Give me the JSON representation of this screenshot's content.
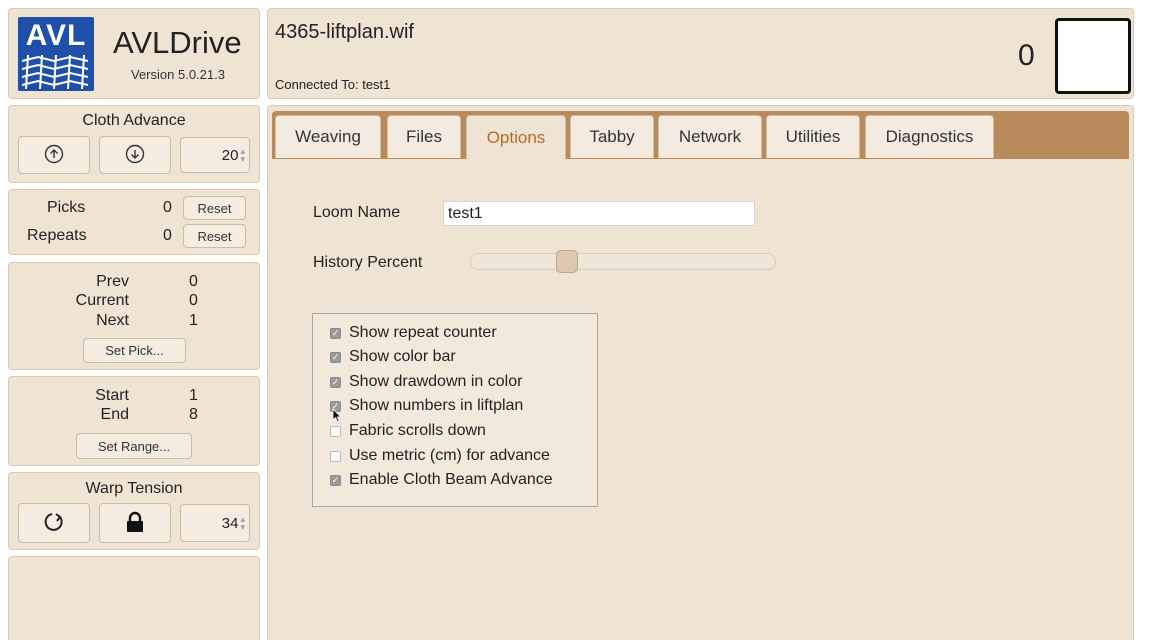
{
  "app": {
    "logo_text": "AVL",
    "name": "AVLDrive",
    "version": "Version 5.0.21.3"
  },
  "header": {
    "file_name": "4365-liftplan.wif",
    "connected": "Connected To: test1",
    "counter": "0"
  },
  "cloth_advance": {
    "title": "Cloth Advance",
    "up_icon": "arrow-up-circle-icon",
    "down_icon": "arrow-down-circle-icon",
    "value": "20"
  },
  "counters": {
    "picks_label": "Picks",
    "picks_value": "0",
    "repeats_label": "Repeats",
    "repeats_value": "0",
    "reset_label": "Reset"
  },
  "pick_info": {
    "prev_label": "Prev",
    "prev_value": "0",
    "current_label": "Current",
    "current_value": "0",
    "next_label": "Next",
    "next_value": "1",
    "set_pick_label": "Set Pick..."
  },
  "range": {
    "start_label": "Start",
    "start_value": "1",
    "end_label": "End",
    "end_value": "8",
    "set_range_label": "Set Range..."
  },
  "warp_tension": {
    "title": "Warp Tension",
    "value": "34",
    "refresh_icon": "refresh-icon",
    "lock_icon": "lock-icon"
  },
  "tabs": [
    {
      "label": "Weaving"
    },
    {
      "label": "Files"
    },
    {
      "label": "Options",
      "active": true
    },
    {
      "label": "Tabby"
    },
    {
      "label": "Network"
    },
    {
      "label": "Utilities"
    },
    {
      "label": "Diagnostics"
    }
  ],
  "options": {
    "loom_name_label": "Loom Name",
    "loom_name_value": "test1",
    "history_label": "History Percent",
    "history_value_fraction": 0.3,
    "checkboxes": [
      {
        "label": "Show repeat counter",
        "checked": true
      },
      {
        "label": "Show color bar",
        "checked": true
      },
      {
        "label": "Show drawdown in color",
        "checked": true
      },
      {
        "label": "Show numbers in liftplan",
        "checked": true
      },
      {
        "label": "Fabric scrolls down",
        "checked": false
      },
      {
        "label": "Use metric (cm) for advance",
        "checked": false
      },
      {
        "label": "Enable Cloth Beam Advance",
        "checked": true
      }
    ]
  },
  "colors": {
    "panel": "#efe3d3",
    "tab_bar": "#b98a5c",
    "active_tab_text": "#c0671e",
    "logo_blue": "#1f4fa8"
  }
}
